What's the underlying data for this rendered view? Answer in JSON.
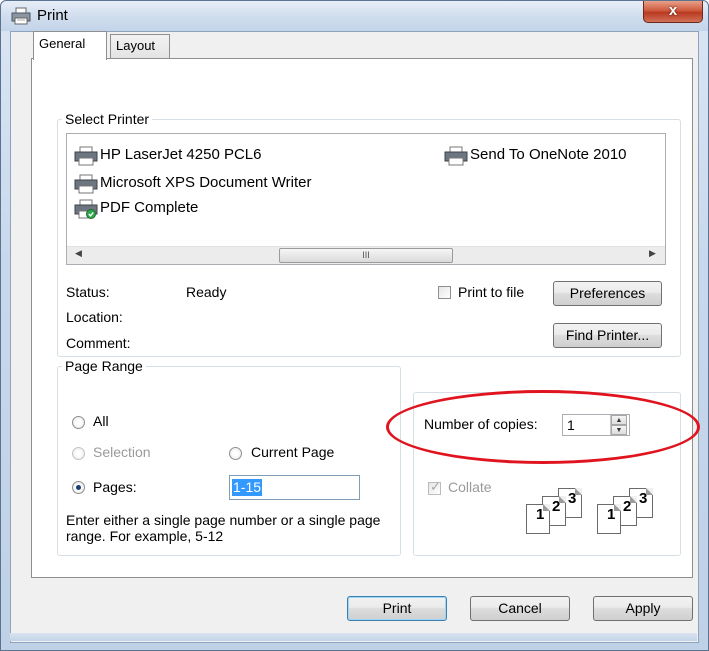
{
  "window": {
    "title": "Print",
    "close_label": "x"
  },
  "tabs": [
    {
      "label": "General",
      "active": true
    },
    {
      "label": "Layout",
      "active": false
    }
  ],
  "select_printer": {
    "legend": "Select Printer",
    "printers": [
      {
        "name": "HP LaserJet 4250 PCL6",
        "icon": "printer-icon"
      },
      {
        "name": "Send To OneNote 2010",
        "icon": "printer-icon"
      },
      {
        "name": "Microsoft XPS Document Writer",
        "icon": "printer-icon"
      },
      {
        "name": "PDF Complete",
        "icon": "printer-default-check-icon"
      }
    ],
    "scroll_thumb_label": "III",
    "status_label": "Status:",
    "status_value": "Ready",
    "location_label": "Location:",
    "comment_label": "Comment:",
    "print_to_file_label": "Print to file",
    "print_to_file_checked": false,
    "preferences_label": "Preferences",
    "find_printer_label": "Find Printer..."
  },
  "page_range": {
    "legend": "Page Range",
    "all_label": "All",
    "selection_label": "Selection",
    "current_page_label": "Current Page",
    "pages_label": "Pages:",
    "pages_value": "1-15",
    "selected": "pages",
    "hint": "Enter either a single page number or a single page range.  For example, 5-12"
  },
  "copies": {
    "label": "Number of copies:",
    "value": "1",
    "collate_label": "Collate",
    "collate_checked": true,
    "collate_enabled": false,
    "stack_pages": [
      "1",
      "2",
      "3"
    ]
  },
  "buttons": {
    "print": "Print",
    "cancel": "Cancel",
    "apply": "Apply"
  },
  "colors": {
    "highlight_oval": "#e0141e",
    "selection_blue": "#3399ff",
    "close_button": "#c44b2f"
  }
}
